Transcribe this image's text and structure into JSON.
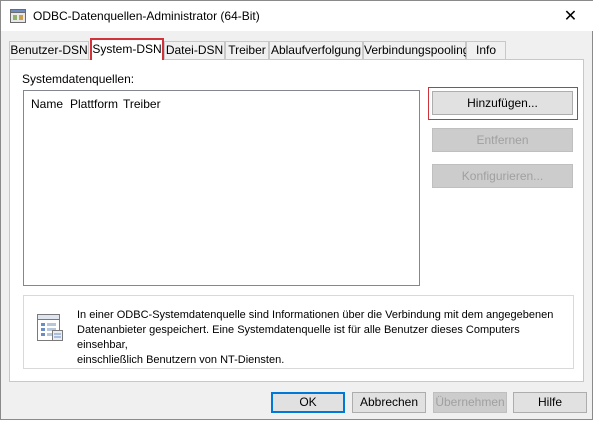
{
  "window": {
    "title": "ODBC-Datenquellen-Administrator (64-Bit)",
    "close_glyph": "✕"
  },
  "tabs": [
    {
      "label": "Benutzer-DSN",
      "active": false
    },
    {
      "label": "System-DSN",
      "active": true
    },
    {
      "label": "Datei-DSN",
      "active": false
    },
    {
      "label": "Treiber",
      "active": false
    },
    {
      "label": "Ablaufverfolgung",
      "active": false
    },
    {
      "label": "Verbindungspooling",
      "active": false
    },
    {
      "label": "Info",
      "active": false
    }
  ],
  "system_dsn": {
    "group_label": "Systemdatenquellen:",
    "columns": [
      "Name",
      "Plattform",
      "Treiber"
    ],
    "rows": []
  },
  "side_buttons": {
    "add": "Hinzufügen...",
    "remove": "Entfernen",
    "configure": "Konfigurieren..."
  },
  "info": {
    "line1": "In einer ODBC-Systemdatenquelle sind Informationen über die Verbindung mit dem angegebenen",
    "line2": "Datenanbieter gespeichert. Eine Systemdatenquelle ist für alle Benutzer dieses Computers einsehbar,",
    "line3": "einschließlich Benutzern von NT-Diensten."
  },
  "footer_buttons": {
    "ok": "OK",
    "cancel": "Abbrechen",
    "apply": "Übernehmen",
    "help": "Hilfe"
  },
  "icons": {
    "title": "odbc-admin-icon",
    "info": "database-document-icon",
    "close": "close-icon"
  },
  "colors": {
    "highlight": "#d0343a",
    "default_button_border": "#0078d7",
    "disabled_text": "#a0a0a0"
  }
}
